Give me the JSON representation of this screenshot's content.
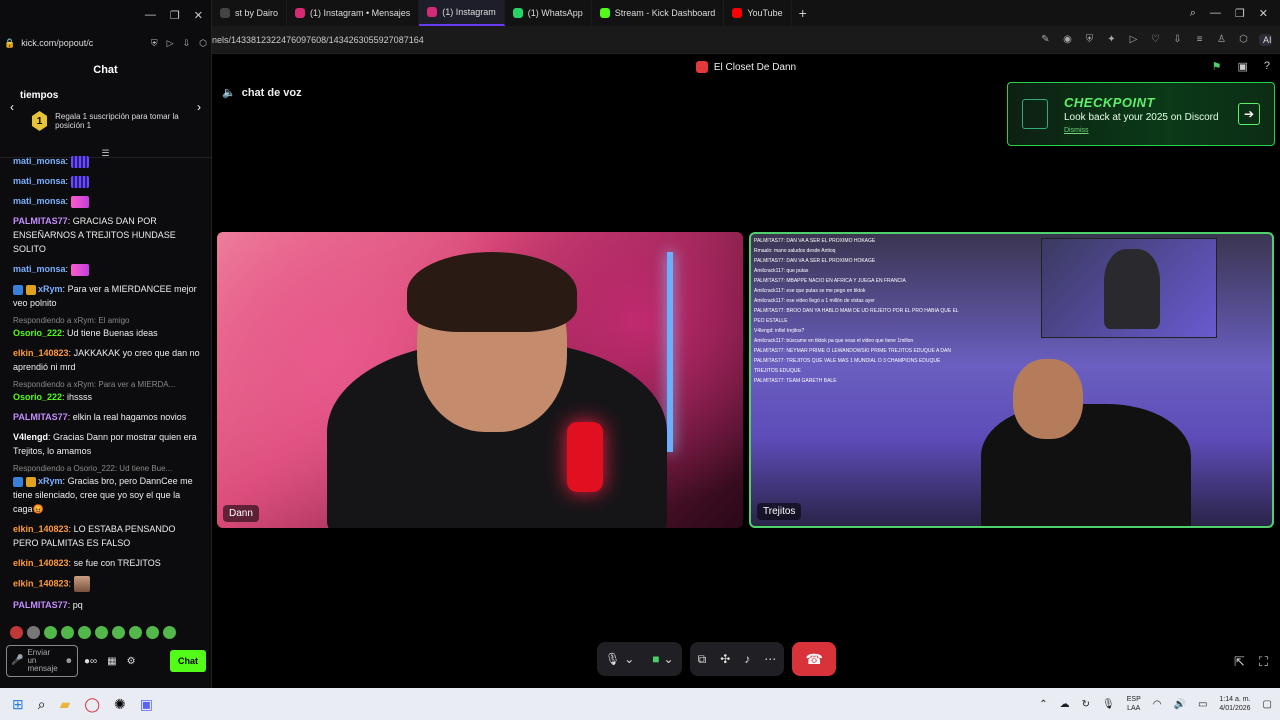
{
  "browser": {
    "tabs": [
      {
        "label": "st by Dairo",
        "color": "#444"
      },
      {
        "label": "(1) Instagram • Mensajes",
        "color": "#d62976"
      },
      {
        "label": "(1) Instagram",
        "color": "#d62976"
      },
      {
        "label": "(1) WhatsApp",
        "color": "#25d366"
      },
      {
        "label": "Stream - Kick Dashboard",
        "color": "#53fc18"
      },
      {
        "label": "YouTube",
        "color": "#ff0000"
      }
    ],
    "url": "nels/1433812322476097608/1434263055927087164",
    "ai_label": "AI"
  },
  "discord": {
    "server_name": "El Closet De Dann",
    "voice_channel": "chat de voz",
    "checkpoint": {
      "title": "CHECKPOINT",
      "subtitle": "Look back at your 2025 on Discord",
      "dismiss": "Dismiss"
    },
    "participants": [
      {
        "name": "Dann"
      },
      {
        "name": "Trejitos"
      }
    ],
    "overlay_chat": [
      "PALMITAS77: DAN VA A SER EL PROXIMO HOKAGE",
      "Rmaalo: mano saludos desde Antioq",
      "PALMITAS77: DAN VA A SER EL PROXIMO HOKAGE",
      "Amilcrack117: que putas",
      "PALMITAS77: MBAPPE NACIO EN AFRICA Y JUEGA EN FRANCIA",
      "Amilcrack117: ese que putas se me pego en tiktok",
      "Amilcrack117: ese video llegó a 1 millón de vistas ayer",
      "PALMITAS77: BROO DAN YA HABLO MAM DE UD REJEITO POR EL PRO HABIA QUE EL PEO ESTALLE",
      "V4lengd: infiel trejitos?",
      "Amilcrack117: búscame en tiktok pa que veas el video que tiene 1millon",
      "PALMITAS77: NEYMAR PRIME O LEWANDOWSKI PRIME TREJITOS EDUQUE A DAN",
      "PALMITAS77: TREJITOS QUE VALE MAS 1 MUNDIAL O 3 CHAMPIONS EDUQUE TREJITOS EDUQUE",
      "PALMITAS77: TEAM GARETH BALE"
    ]
  },
  "kick": {
    "url": "kick.com/popout/c",
    "title": "Chat",
    "sub_banner": {
      "heading": "tiempos",
      "rank": "1",
      "text": "Regala 1 suscripción para tomar la posición 1"
    },
    "messages": [
      {
        "user": "mati_monsa",
        "color": "#7ab0ff",
        "text": "",
        "emote": "grid"
      },
      {
        "user": "mati_monsa",
        "color": "#7ab0ff",
        "text": "",
        "emote": "grid"
      },
      {
        "user": "mati_monsa",
        "color": "#7ab0ff",
        "text": "",
        "emote": "pink"
      },
      {
        "user": "PALMITAS77",
        "color": "#c58cff",
        "text": "GRACIAS DAN POR ENSEÑARNOS A TREJITOS HUNDASE SOLITO"
      },
      {
        "user": "mati_monsa",
        "color": "#7ab0ff",
        "text": "",
        "emote": "pink"
      },
      {
        "user": "xRym",
        "color": "#7ab0ff",
        "text": "Para ver a MIERDANCEE mejor veo polnito",
        "badges": true
      },
      {
        "user": "Osorio_222",
        "color": "#53fc18",
        "text": "Ud tiene Buenas ideas",
        "reply": "Respondiendo a xRym: El amigo"
      },
      {
        "user": "elkin_140823",
        "color": "#ff9a3c",
        "text": "JAKKAKAK yo creo que dan no aprendió ni mrd"
      },
      {
        "user": "Osorio_222",
        "color": "#53fc18",
        "text": "ihssss",
        "reply": "Respondiendo a xRym: Para ver a MIERDA..."
      },
      {
        "user": "PALMITAS77",
        "color": "#c58cff",
        "text": "elkin la real hagamos novios"
      },
      {
        "user": "V4lengd",
        "color": "#ffffff",
        "text": "Gracias Dann por mostrar quien era Trejitos, lo amamos"
      },
      {
        "user": "xRym",
        "color": "#7ab0ff",
        "text": "Gracias bro, pero DannCee me tiene silenciado, cree que yo soy el que la caga😡",
        "reply": "Respondiendo a Osorio_222: Ud tiene Bue...",
        "badges": true
      },
      {
        "user": "elkin_140823",
        "color": "#ff9a3c",
        "text": "LO ESTABA PENSANDO PERO PALMITAS ES FALSO"
      },
      {
        "user": "elkin_140823",
        "color": "#ff9a3c",
        "text": "se fue con TREJITOS"
      },
      {
        "user": "elkin_140823",
        "color": "#ff9a3c",
        "text": "",
        "emote": "pic"
      },
      {
        "user": "PALMITAS77",
        "color": "#c58cff",
        "text": "pq"
      }
    ],
    "input_placeholder": "Enviar un mensaje",
    "chat_button": "Chat"
  },
  "taskbar": {
    "lang_top": "ESP",
    "lang_bottom": "LAA",
    "time": "1:14 a. m.",
    "date": "4/01/2026"
  }
}
